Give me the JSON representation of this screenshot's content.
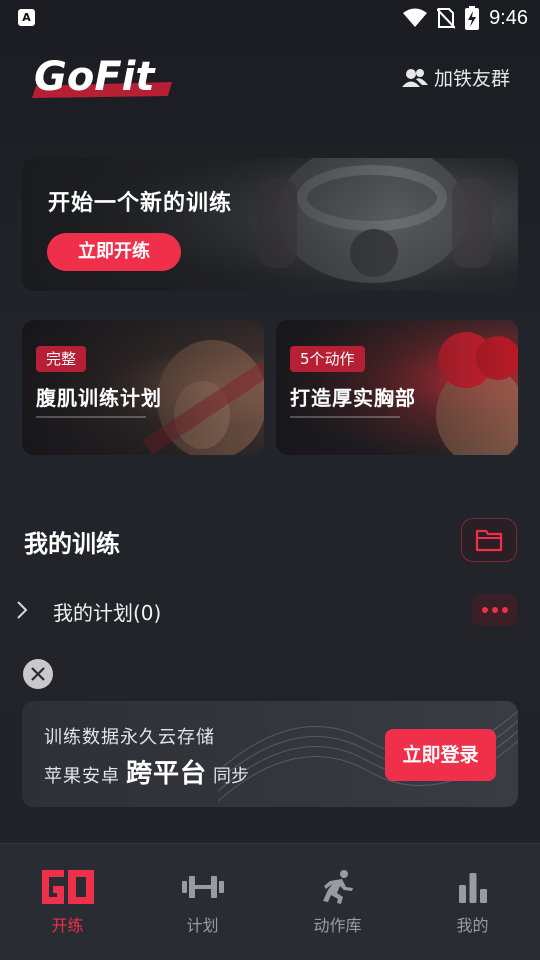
{
  "status_bar": {
    "time": "9:46",
    "app_badge": "A"
  },
  "header": {
    "logo_text": "GoFit",
    "group_button_label": "加铁友群"
  },
  "hero": {
    "title": "开始一个新的训练",
    "button_label": "立即开练"
  },
  "programs": [
    {
      "tag": "完整",
      "title": "腹肌训练计划"
    },
    {
      "tag": "5个动作",
      "title": "打造厚实胸部"
    }
  ],
  "my_training": {
    "section_title": "我的训练",
    "plan_label": "我的计划(0)"
  },
  "cloud_banner": {
    "line1": "训练数据永久云存储",
    "line2_prefix": "苹果安卓",
    "line2_emphasis": "跨平台",
    "line2_suffix": "同步",
    "login_button_label": "立即登录"
  },
  "bottom_nav": {
    "items": [
      {
        "label": "开练",
        "icon": "go-icon",
        "active": true
      },
      {
        "label": "计划",
        "icon": "dumbbell-icon",
        "active": false
      },
      {
        "label": "动作库",
        "icon": "running-person-icon",
        "active": false
      },
      {
        "label": "我的",
        "icon": "bar-chart-icon",
        "active": false
      }
    ]
  },
  "colors": {
    "accent": "#f0304a",
    "background": "#202227",
    "nav_background": "#2a2c33",
    "inactive": "#9a9ba2"
  }
}
